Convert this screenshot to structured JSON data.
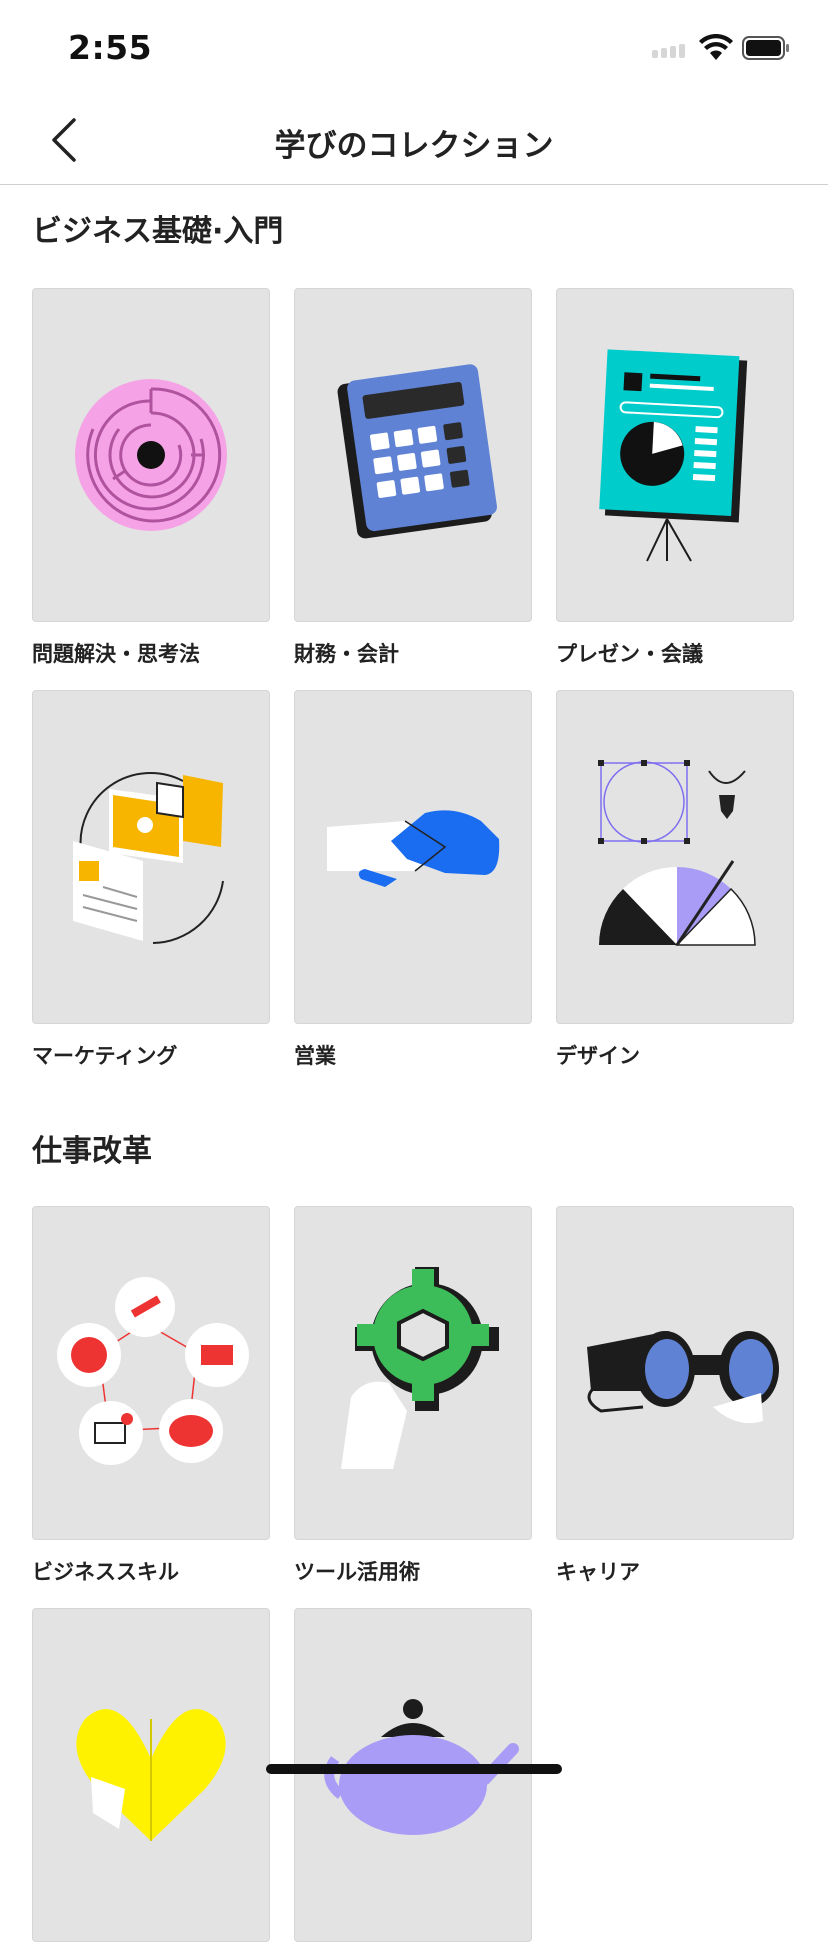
{
  "status_bar": {
    "time": "2:55"
  },
  "nav": {
    "title": "学びのコレクション"
  },
  "sections": [
    {
      "title": "ビジネス基礎·入門",
      "items": [
        {
          "label": "問題解決・思考法",
          "icon": "maze-icon"
        },
        {
          "label": "財務・会計",
          "icon": "calculator-icon"
        },
        {
          "label": "プレゼン・会議",
          "icon": "presentation-board-icon"
        },
        {
          "label": "マーケティング",
          "icon": "marketing-screens-icon"
        },
        {
          "label": "営業",
          "icon": "handshake-icon"
        },
        {
          "label": "デザイン",
          "icon": "design-tools-icon"
        }
      ]
    },
    {
      "title": "仕事改革",
      "items": [
        {
          "label": "ビジネススキル",
          "icon": "skill-network-icon"
        },
        {
          "label": "ツール活用術",
          "icon": "gear-hand-icon"
        },
        {
          "label": "キャリア",
          "icon": "binoculars-icon"
        },
        {
          "label": "",
          "icon": "puzzle-heart-icon"
        },
        {
          "label": "",
          "icon": "teapot-icon"
        }
      ]
    }
  ],
  "colors": {
    "card_bg": "#e3e3e3",
    "accent_blue": "#1a6cf0",
    "accent_pink": "#f5a3e6",
    "accent_teal": "#00cccc",
    "accent_yellow": "#f7b500",
    "accent_green": "#3dbd5a",
    "accent_red": "#ee3333"
  }
}
